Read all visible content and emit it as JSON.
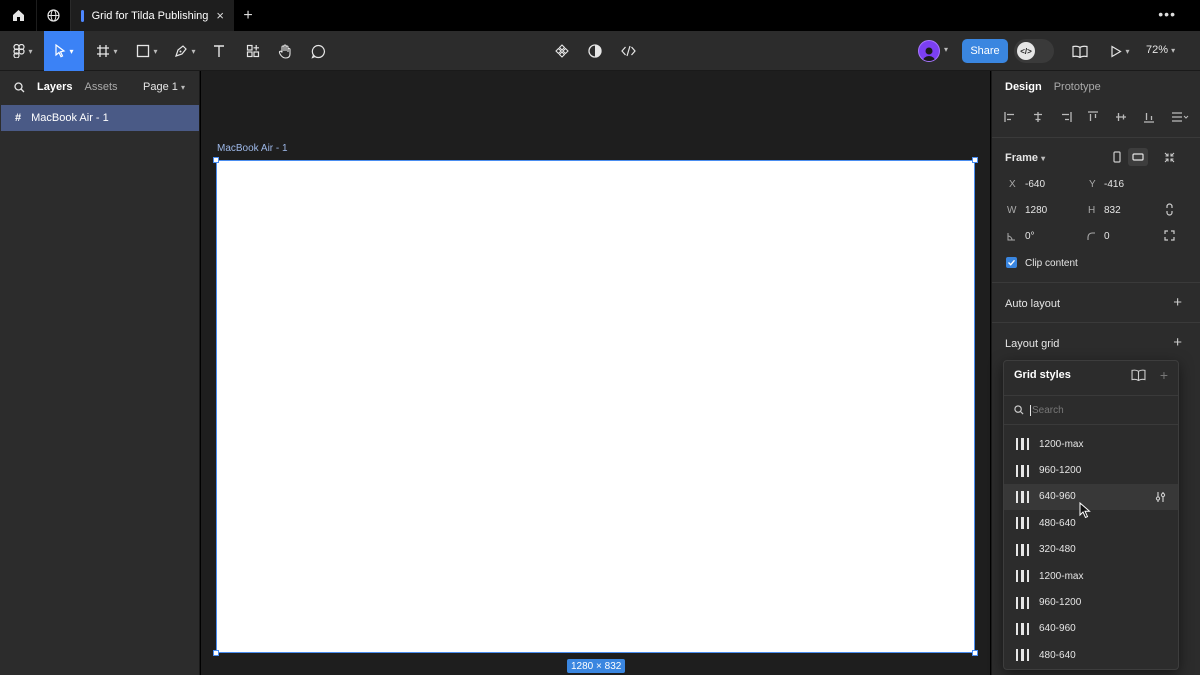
{
  "tabbar": {
    "tab_title": "Grid for Tilda Publishing",
    "close_glyph": "×",
    "add_glyph": "+",
    "more_glyph": "•••"
  },
  "toolbar": {
    "share_label": "Share",
    "zoom_label": "72%",
    "tools": [
      "main-menu",
      "move",
      "frame",
      "shape",
      "pen",
      "text",
      "resources",
      "hand",
      "comment"
    ],
    "center_tools": [
      "component",
      "contrast",
      "code"
    ]
  },
  "left_panel": {
    "tab_layers": "Layers",
    "tab_assets": "Assets",
    "page_label": "Page 1",
    "layers": [
      {
        "icon": "#",
        "label": "MacBook Air - 1"
      }
    ]
  },
  "canvas": {
    "frame_label": "MacBook Air - 1",
    "size_badge": "1280 × 832"
  },
  "right_panel": {
    "tab_design": "Design",
    "tab_prototype": "Prototype",
    "frame_title": "Frame",
    "x_label": "X",
    "x_value": "-640",
    "y_label": "Y",
    "y_value": "-416",
    "w_label": "W",
    "w_value": "1280",
    "h_label": "H",
    "h_value": "832",
    "rotation_value": "0°",
    "radius_value": "0",
    "clip_content_label": "Clip content",
    "clip_content_checked": true,
    "auto_layout_title": "Auto layout",
    "layout_grid_title": "Layout grid"
  },
  "grid_styles": {
    "title": "Grid styles",
    "search_placeholder": "Search",
    "hovered_index": 2,
    "items": [
      "1200-max",
      "960-1200",
      "640-960",
      "480-640",
      "320-480",
      "1200-max",
      "960-1200",
      "640-960",
      "480-640"
    ]
  },
  "colors": {
    "accent": "#3a86e0",
    "selection": "#4a5a86",
    "panel": "#2c2c2c",
    "canvas": "#1e1e1e"
  }
}
